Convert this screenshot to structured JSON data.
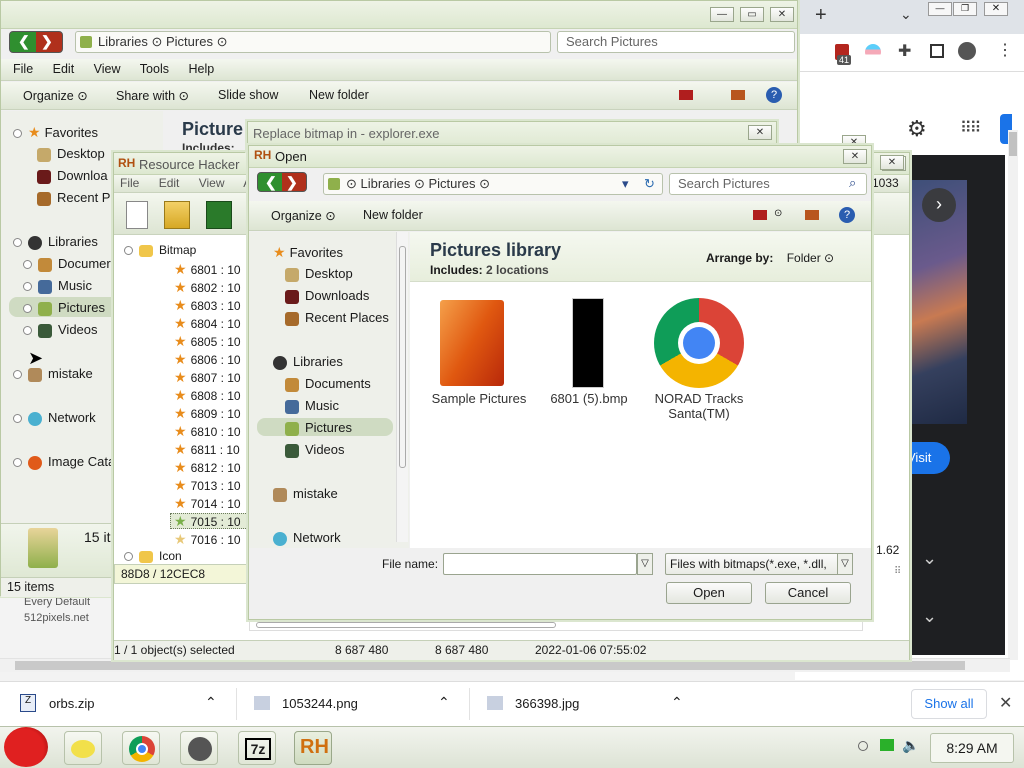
{
  "colors": {
    "accent": "#1a73e8",
    "hover": "#cfdbc2"
  },
  "explorer": {
    "title_address": [
      "Libraries",
      "Pictures"
    ],
    "search_placeholder": "Search Pictures",
    "menu": [
      "File",
      "Edit",
      "View",
      "Tools",
      "Help"
    ],
    "toolbar": [
      "Organize",
      "Share with",
      "Slide show",
      "New folder"
    ],
    "nav": {
      "favorites": "Favorites",
      "desktop": "Desktop",
      "downloads": "Downloa",
      "recent": "Recent P",
      "libraries": "Libraries",
      "documents": "Documer",
      "music": "Music",
      "pictures": "Pictures",
      "videos": "Videos",
      "mistake": "mistake",
      "network": "Network",
      "image_catalog": "Image Cata"
    },
    "content_title": "Picture",
    "content_sub": "Includes:",
    "footer_count": "15 it",
    "status": "15 items"
  },
  "reshacker": {
    "title": "Resource Hacker",
    "menu": [
      "File",
      "Edit",
      "View",
      "Ac"
    ],
    "tree_root": "Bitmap",
    "items": [
      "6801 : 10",
      "6802 : 10",
      "6803 : 10",
      "6804 : 10",
      "6805 : 10",
      "6806 : 10",
      "6807 : 10",
      "6808 : 10",
      "6809 : 10",
      "6810 : 10",
      "6811 : 10",
      "6812 : 10",
      "7013 : 10",
      "7014 : 10",
      "7015 : 10",
      "7016 : 10"
    ],
    "icon_node": "Icon",
    "status_left": "88D8 / 12CEC8",
    "status_sel": "1 / 1 object(s) selected",
    "status_size1": "8 687 480",
    "status_size2": "8 687 480",
    "status_date": "2022-01-06 07:55:02",
    "right_num": "1033",
    "right_num2": "1.62"
  },
  "replace_dialog": {
    "title": "Replace bitmap in - explorer.exe"
  },
  "open_dialog": {
    "title": "Open",
    "address": [
      "Libraries",
      "Pictures"
    ],
    "search_placeholder": "Search Pictures",
    "toolbar": [
      "Organize",
      "New folder"
    ],
    "nav": {
      "favorites": "Favorites",
      "desktop": "Desktop",
      "downloads": "Downloads",
      "recent": "Recent Places",
      "libraries": "Libraries",
      "documents": "Documents",
      "music": "Music",
      "pictures": "Pictures",
      "videos": "Videos",
      "mistake": "mistake",
      "network": "Network"
    },
    "lib_title": "Pictures library",
    "lib_includes": "Includes:",
    "lib_locations": "2 locations",
    "arrange_label": "Arrange by:",
    "arrange_value": "Folder",
    "files": [
      {
        "name": "Sample Pictures"
      },
      {
        "name": "6801 (5).bmp"
      },
      {
        "name": "NORAD Tracks Santa(TM)"
      }
    ],
    "filename_label": "File name:",
    "filename_value": "",
    "filter": "Files with bitmaps(*.exe, *.dll,",
    "open_btn": "Open",
    "cancel_btn": "Cancel"
  },
  "browser": {
    "tab_plus": "+",
    "badge": "41",
    "visit": "Visit",
    "footer_left1": "Every Default",
    "footer_left2": "512pixels.net"
  },
  "downloads": [
    {
      "name": "orbs.zip"
    },
    {
      "name": "1053244.png"
    },
    {
      "name": "366398.jpg"
    }
  ],
  "downloads_show_all": "Show all",
  "clock": "8:29 AM"
}
